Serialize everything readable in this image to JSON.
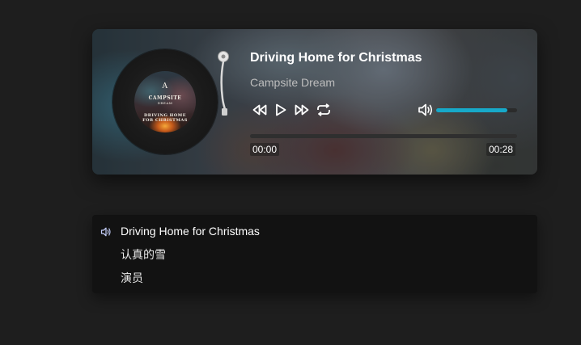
{
  "player": {
    "title": "Driving Home for Christmas",
    "artist": "Campsite Dream",
    "current_time": "00:00",
    "duration": "00:28",
    "progress": 0.0,
    "volume": 0.88,
    "accent_color": "#17a9c9",
    "controls": {
      "prev_icon": "rewind-icon",
      "play_icon": "play-icon",
      "next_icon": "fast-forward-icon",
      "repeat_icon": "repeat-icon",
      "volume_icon": "volume-icon"
    },
    "cover": {
      "logo": "A",
      "brand_line1": "CAMPSITE",
      "brand_line2": "DREAM",
      "title_line1": "DRIVING HOME",
      "title_line2": "FOR CHRISTMAS"
    }
  },
  "playlist": {
    "items": [
      {
        "label": "Driving Home for Christmas",
        "active": true
      },
      {
        "label": "认真的雪",
        "active": false
      },
      {
        "label": "演员",
        "active": false
      }
    ],
    "active_icon": "speaker-icon"
  }
}
